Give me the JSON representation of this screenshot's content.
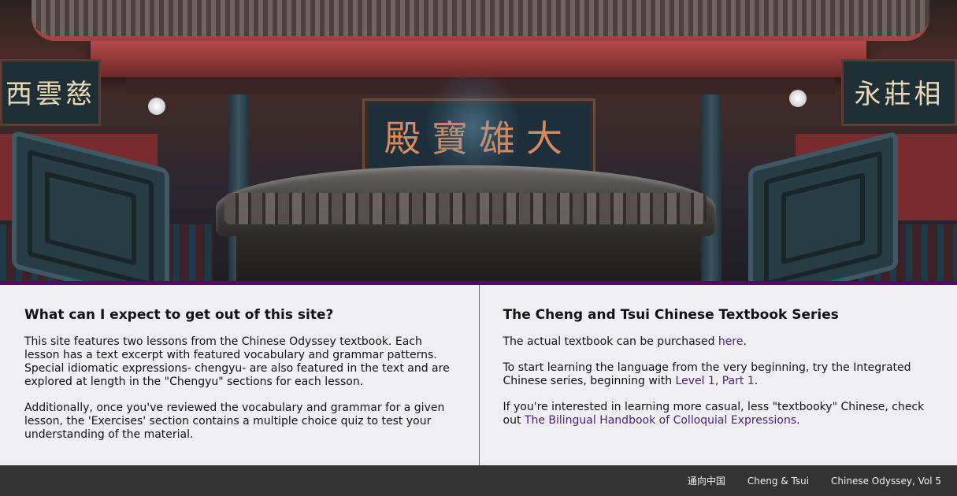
{
  "hero": {
    "image": "temple-incense-burner-photo",
    "plaque_text": "殿寶雄大",
    "left_sign_text": "西雲慈",
    "right_sign_text": "永莊相"
  },
  "left_panel": {
    "heading": "What can I expect to get out of this site?",
    "paragraph_1": "This site features two lessons from the Chinese Odyssey textbook. Each lesson has a text excerpt with featured vocabulary and grammar patterns. Special idiomatic expressions- chengyu- are also featured in the text and are explored at length in the \"Chengyu\" sections for each lesson.",
    "paragraph_2": "Additionally, once you've reviewed the vocabulary and grammar for a given lesson, the 'Exercises' section contains a multiple choice quiz to test your understanding of the material."
  },
  "right_panel": {
    "heading": "The Cheng and Tsui Chinese Textbook Series",
    "p1_text": "The actual textbook can be purchased ",
    "p1_link": "here",
    "p1_end": ".",
    "p2_text": "To start learning the language from the very beginning, try the Integrated Chinese series, beginning with ",
    "p2_link": "Level 1, Part 1",
    "p2_end": ".",
    "p3_text": "If you're interested in learning more casual, less \"textbooky\" Chinese, check out ",
    "p3_link": "The Bilingual Handbook of Colloquial Expressions",
    "p3_end": "."
  },
  "colors": {
    "accent_rule": "#4b0f5c",
    "link": "#4a1f7a",
    "footer_bg": "#333334",
    "panel_bg": "#efeff1"
  },
  "footer": {
    "links": [
      "通向中国",
      "Cheng & Tsui",
      "Chinese Odyssey, Vol 5"
    ]
  }
}
